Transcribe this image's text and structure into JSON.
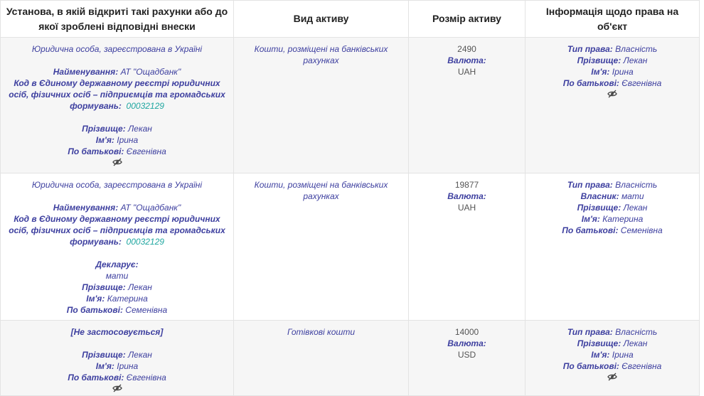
{
  "headers": {
    "institution": "Установа, в якій відкриті такі рахунки або до якої зроблені відповідні внески",
    "asset_type": "Вид активу",
    "asset_size": "Розмір активу",
    "right_info": "Інформація щодо права на об'єкт"
  },
  "labels": {
    "name": "Найменування:",
    "edrpou": "Код в Єдиному державному реєстрі юридичних осіб, фізичних осіб – підприємців та громадських формувань:",
    "surname": "Прізвище:",
    "first_name": "Ім'я:",
    "patronymic": "По батькові:",
    "currency": "Валюта:",
    "right_type": "Тип права:",
    "owner": "Власник:",
    "declarant": "Декларує:"
  },
  "rows": [
    {
      "institution": {
        "entity_type": "Юридична особа, зареєстрована в Україні",
        "name": "АТ \"Ощадбанк\"",
        "code": "00032129",
        "surname": "Лекан",
        "first_name": "Ірина",
        "patronymic": "Євгенівна"
      },
      "asset_type": "Кошти, розміщені на банківських рахунках",
      "amount": "2490",
      "currency": "UAH",
      "right": {
        "right_type": "Власність",
        "surname": "Лекан",
        "first_name": "Ірина",
        "patronymic": "Євгенівна"
      }
    },
    {
      "institution": {
        "entity_type": "Юридична особа, зареєстрована в Україні",
        "name": "АТ \"Ощадбанк\"",
        "code": "00032129",
        "declarant": "мати",
        "surname": "Лекан",
        "first_name": "Катерина",
        "patronymic": "Семенівна"
      },
      "asset_type": "Кошти, розміщені на банківських рахунках",
      "amount": "19877",
      "currency": "UAH",
      "right": {
        "right_type": "Власність",
        "owner": "мати",
        "surname": "Лекан",
        "first_name": "Катерина",
        "patronymic": "Семенівна"
      }
    },
    {
      "institution": {
        "not_applicable": "[Не застосовується]",
        "surname": "Лекан",
        "first_name": "Ірина",
        "patronymic": "Євгенівна"
      },
      "asset_type": "Готівкові кошти",
      "amount": "14000",
      "currency": "USD",
      "right": {
        "right_type": "Власність",
        "surname": "Лекан",
        "first_name": "Ірина",
        "patronymic": "Євгенівна"
      }
    }
  ],
  "icons": {
    "hidden_info": "eye-slash-icon"
  },
  "colors": {
    "text_blue": "#3d3f9f",
    "code_teal": "#1fa6a0",
    "row_shade": "#f6f6f6",
    "border": "#e3e3e3"
  }
}
